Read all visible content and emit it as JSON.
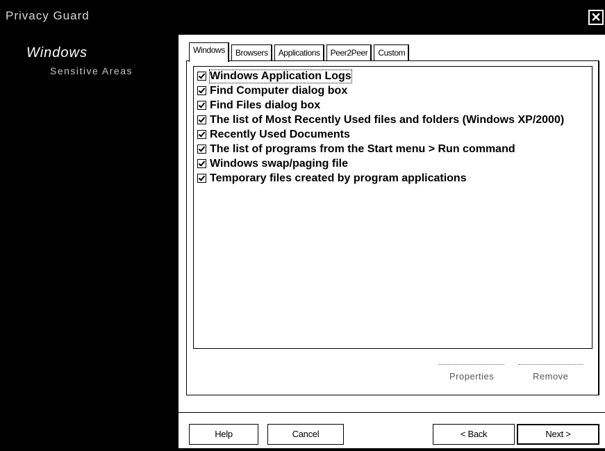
{
  "window": {
    "title": "Privacy Guard",
    "close_label": "✕"
  },
  "sidebar": {
    "heading": "Windows",
    "subheading": "Sensitive Areas"
  },
  "tabs": [
    {
      "label": "Windows",
      "active": true
    },
    {
      "label": "Browsers",
      "active": false
    },
    {
      "label": "Applications",
      "active": false
    },
    {
      "label": "Peer2Peer",
      "active": false
    },
    {
      "label": "Custom",
      "active": false
    }
  ],
  "list": {
    "items": [
      {
        "label": "Windows Application Logs",
        "checked": true
      },
      {
        "label": "Find Computer dialog box",
        "checked": true
      },
      {
        "label": "Find Files dialog box",
        "checked": true
      },
      {
        "label": "The list of Most Recently Used files and folders (Windows XP/2000)",
        "checked": true
      },
      {
        "label": "Recently Used Documents",
        "checked": true
      },
      {
        "label": "The list of programs from the Start menu > Run command",
        "checked": true
      },
      {
        "label": "Windows swap/paging file",
        "checked": true
      },
      {
        "label": "Temporary files created by program applications",
        "checked": true
      }
    ]
  },
  "actions": {
    "properties_label": "Properties",
    "remove_label": "Remove"
  },
  "buttons": {
    "help": "Help",
    "cancel": "Cancel",
    "back": "< Back",
    "next": "Next >"
  }
}
